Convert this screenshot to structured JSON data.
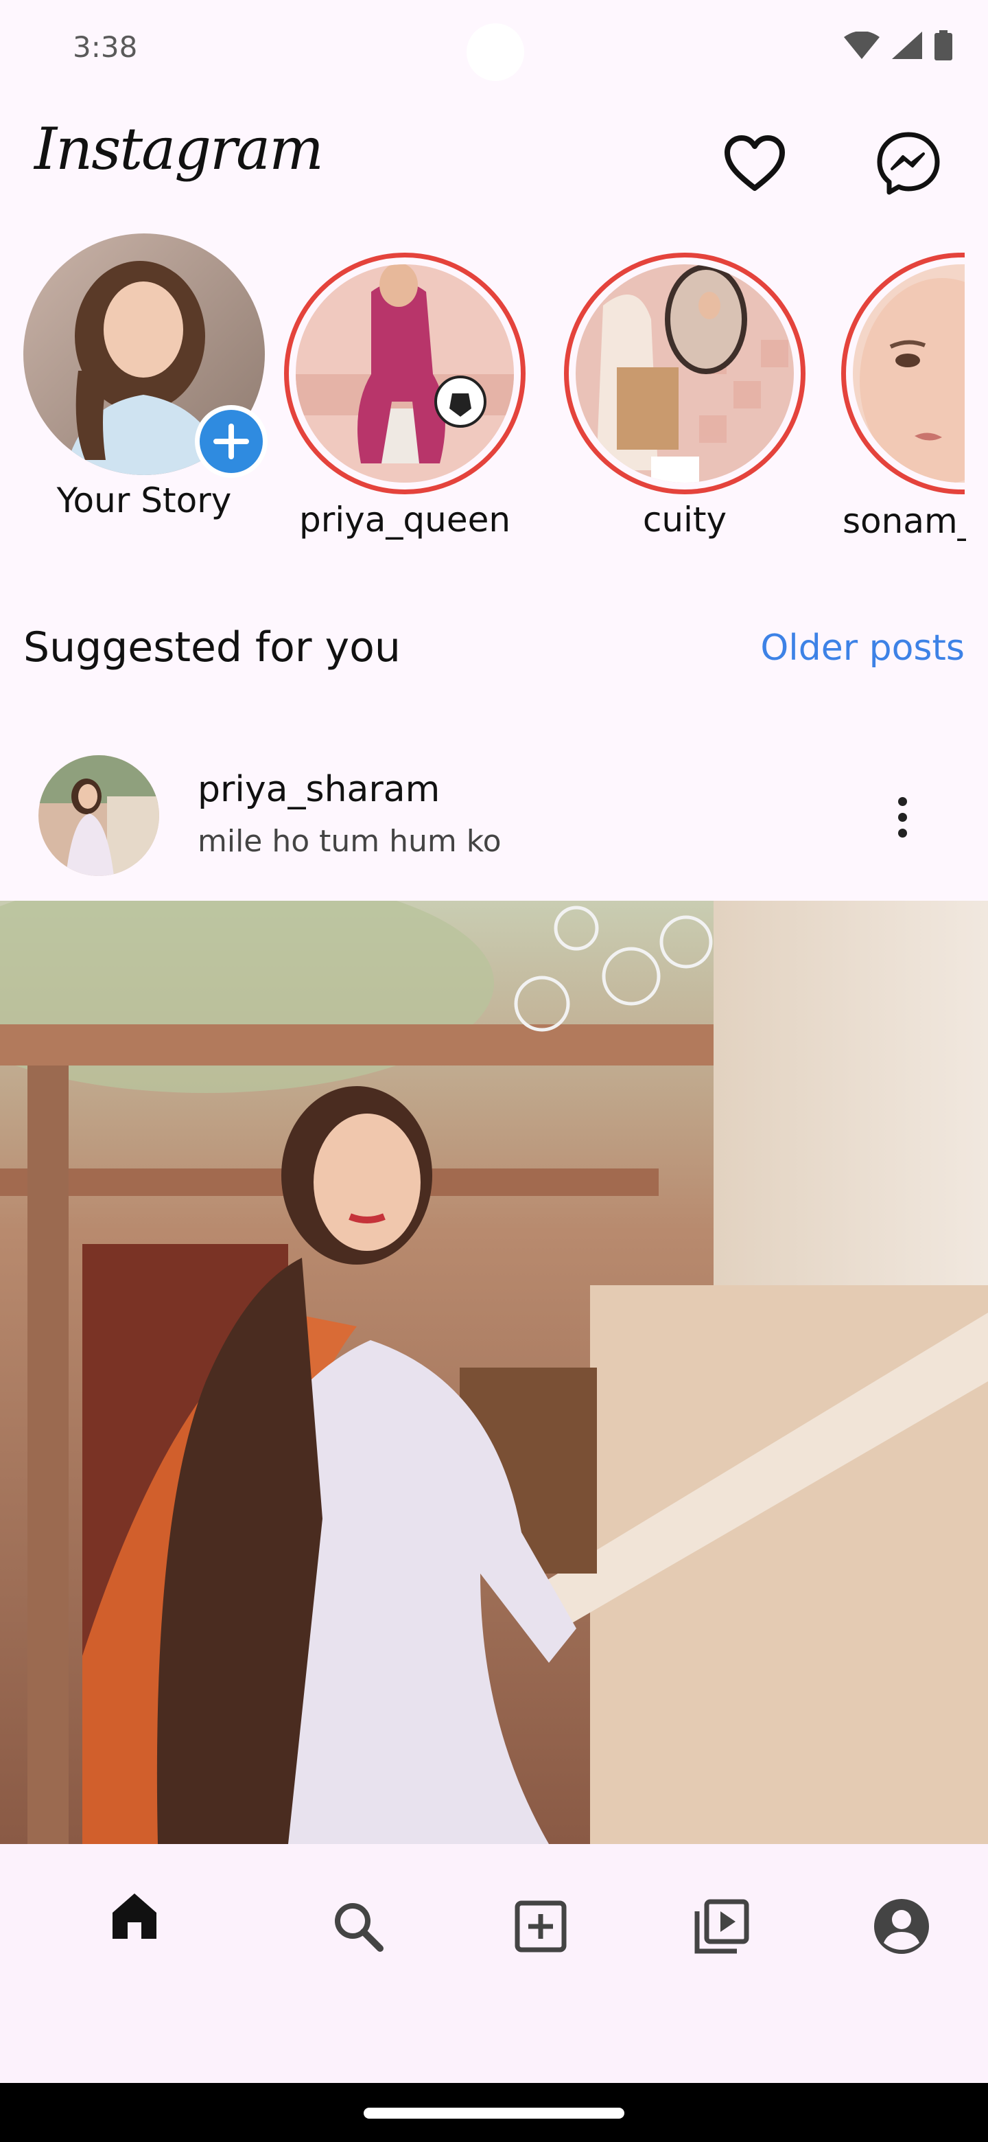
{
  "status_bar": {
    "time": "3:38",
    "icons": [
      "wifi-icon",
      "cellular-signal-icon",
      "battery-icon"
    ]
  },
  "app_bar": {
    "logo": "Instagram",
    "actions": [
      "heart-icon",
      "messenger-icon"
    ]
  },
  "stories": [
    {
      "label": "Your Story",
      "is_own": true,
      "badge": "add-icon"
    },
    {
      "label": "priya_queen",
      "is_own": false
    },
    {
      "label": "cuity",
      "is_own": false
    },
    {
      "label": "sonam_",
      "is_own": false
    }
  ],
  "suggested": {
    "title": "Suggested for you",
    "older_posts_label": "Older posts"
  },
  "post": {
    "username": "priya_sharam",
    "caption": "mile ho tum hum ko",
    "menu_icon": "more-vertical-icon"
  },
  "bottom_nav": {
    "items": [
      "home-icon",
      "search-icon",
      "add-post-icon",
      "reels-icon",
      "profile-icon"
    ],
    "active": "home-icon"
  },
  "colors": {
    "background": "#fef7fe",
    "story_ring": "#e4433c",
    "link": "#3d82e6",
    "add_badge": "#2f8be0"
  }
}
